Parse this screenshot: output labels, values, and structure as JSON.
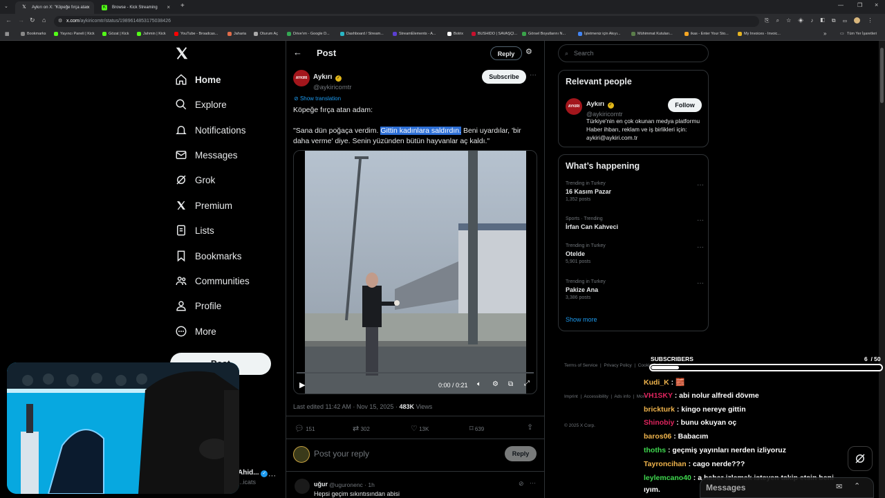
{
  "browser": {
    "tabs": [
      {
        "title": "Aykırı on X: \"Köpeğe fırça atan",
        "active": true
      },
      {
        "title": "Browse - Kick Streaming",
        "active": false
      }
    ],
    "url_host": "x.com",
    "url_path": "/aykiricomtr/status/1989614853175038426",
    "bookmarks": [
      "Bookmarks",
      "Yayıncı Paneli | Kick",
      "Gözat | Kick",
      "Jahmin | Kick",
      "YouTube - Broadcas...",
      "Jaharia",
      "Oturum Aç",
      "Drive'ım - Google D...",
      "Dashboard / Stream...",
      "StreamElements - A...",
      "Botrix",
      "BUSHIDO | SAVAŞÇI...",
      "Görsel Boyutlarını N...",
      "İşletmeniz için Akıyı...",
      "Mühimmat Kutuları...",
      "ikas - Enter Your Sto...",
      "My Invoices - Invoic..."
    ],
    "bookmarks_more": "»",
    "all_bookmarks": "Tüm Yer İşaretleri"
  },
  "nav": {
    "items": [
      "Home",
      "Explore",
      "Notifications",
      "Messages",
      "Grok",
      "Premium",
      "Lists",
      "Bookmarks",
      "Communities",
      "Profile",
      "More"
    ],
    "post_button": "Post",
    "account_name": "Ahid...",
    "account_handle": "...icats"
  },
  "post": {
    "header_title": "Post",
    "reply_label": "Reply",
    "author_name": "Aykırı",
    "author_handle": "@aykiricomtr",
    "avatar_text": "AYKIRI",
    "subscribe_label": "Subscribe",
    "show_translation": "Show translation",
    "line1": "Köpeğe fırça atan adam:",
    "line2_pre": "\"Sana dün poğaça verdim. ",
    "line2_sel": "Gittin kadınlara saldırdın.",
    "line2_post": " Beni uyardılar, 'bir daha verme' diye. Senin yüzünden bütün hayvanlar aç kaldı.\"",
    "video_time": "0:00 / 0:21",
    "video_progress": 0.0,
    "edited": "Last edited 11:42 AM · Nov 15, 2025 · ",
    "views_count": "483K",
    "views_label": " Views",
    "stats": {
      "replies": "151",
      "reposts": "302",
      "likes": "13K",
      "bookmarks": "639"
    },
    "reply_placeholder": "Post your reply",
    "reply_button": "Reply",
    "comment_name": "uğur",
    "comment_handle": "@uguronenc · 1h",
    "comment_text": "Hepsi geçim sıkıntısından abisi"
  },
  "right": {
    "search_placeholder": "Search",
    "relevant_title": "Relevant people",
    "person_name": "Aykırı",
    "person_handle": "@aykiricomtr",
    "follow_label": "Follow",
    "person_bio": "Türkiye'nin en çok okunan medya platformu Haber ihbarı, reklam ve iş birlikleri için: aykiri@aykiri.com.tr",
    "happening_title": "What’s happening",
    "trends": [
      {
        "meta": "Trending in Turkey",
        "name": "16 Kasım Pazar",
        "count": "1,352 posts"
      },
      {
        "meta": "Sports · Trending",
        "name": "İrfan Can Kahveci",
        "count": ""
      },
      {
        "meta": "Trending in Turkey",
        "name": "Otelde",
        "count": "5,901 posts"
      },
      {
        "meta": "Trending in Turkey",
        "name": "Pakize Ana",
        "count": "3,386 posts"
      }
    ],
    "show_more": "Show more",
    "footer_line1": "Terms of Service  |  Privacy Policy  |  Cookie Policy  |",
    "footer_line2": "Imprint  |  Accessibility  |  Ads info  |  More ···",
    "footer_copy": "© 2025 X Corp."
  },
  "overlay": {
    "subs_label": "SUBSCRIBERS",
    "subs_count": "6  / 50",
    "subs_progress": 0.12,
    "chat": [
      {
        "user": "Kudi_K",
        "color": "#f0b44c",
        "msg": " : 🧱"
      },
      {
        "user": "VH1SKY",
        "color": "#e0245e",
        "msg": " : abi nolur alfredi dövme"
      },
      {
        "user": "brickturk",
        "color": "#f0b44c",
        "msg": " : kingo nereye gittin"
      },
      {
        "user": "Shinobiy",
        "color": "#e0245e",
        "msg": " : bunu okuyan oç"
      },
      {
        "user": "baros06",
        "color": "#f0b44c",
        "msg": " : Babacım"
      },
      {
        "user": "thoths",
        "color": "#3fd94f",
        "msg": " : geçmiş yayınları nerden izliyoruz"
      },
      {
        "user": "Tayroncihan",
        "color": "#f0b44c",
        "msg": " : cago nerde???"
      },
      {
        "user": "leylemcano40",
        "color": "#3fd94f",
        "msg": " : a haber izlemek isteyen takip etsin beni"
      }
    ],
    "chat_tail": "ıyım.",
    "messages_label": "Messages"
  }
}
